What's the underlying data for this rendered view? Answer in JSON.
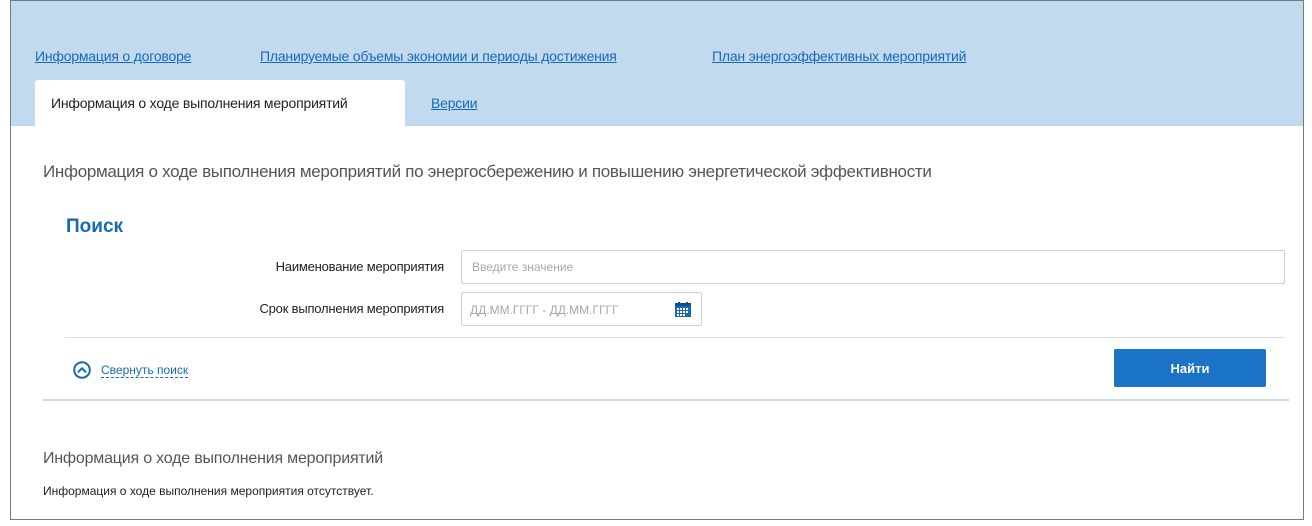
{
  "tabs": {
    "row1": [
      {
        "label": "Информация о договоре"
      },
      {
        "label": "Планируемые объемы экономии и периоды достижения"
      },
      {
        "label": "План энергоэффективных мероприятий"
      }
    ],
    "active": "Информация о ходе выполнения мероприятий",
    "versions": "Версии"
  },
  "section_title": "Информация о ходе выполнения мероприятий по энергосбережению и повышению энергетической эффективности",
  "search": {
    "title": "Поиск",
    "name_label": "Наименование мероприятия",
    "name_placeholder": "Введите значение",
    "name_value": "",
    "date_label": "Срок выполнения мероприятия",
    "date_placeholder": "ДД.ММ.ГГГГ - ДД.ММ.ГГГГ",
    "collapse_label": "Свернуть поиск",
    "find_button": "Найти"
  },
  "info": {
    "title": "Информация о ходе выполнения мероприятий",
    "empty_text": "Информация о ходе выполнения мероприятия отсутствует."
  },
  "colors": {
    "tabbar_bg": "#c2daf0",
    "link": "#1769b7",
    "button": "#1a73c4"
  }
}
